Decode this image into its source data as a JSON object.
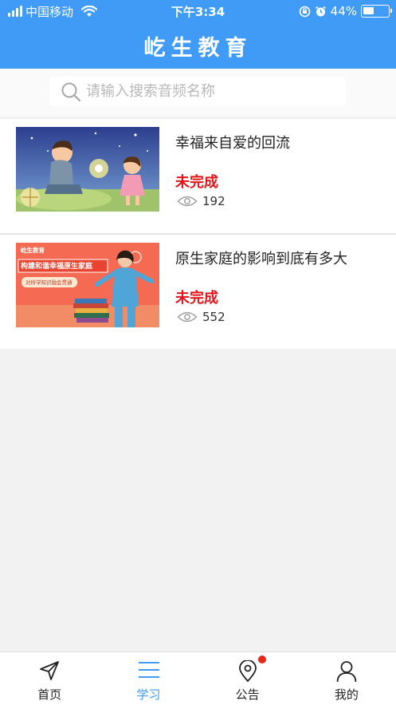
{
  "status_bar": {
    "carrier": "中国移动",
    "time": "下午3:34",
    "battery": "44%",
    "battery_level": 0.44
  },
  "header": {
    "title": "屹生教育"
  },
  "search": {
    "placeholder": "请输入搜索音频名称"
  },
  "items": [
    {
      "title": "幸福来自爱的回流",
      "status": "未完成",
      "views": "192"
    },
    {
      "title": "原生家庭的影响到底有多大",
      "status": "未完成",
      "views": "552",
      "thumb_texts": [
        "屹生教育",
        "构建和谐幸福原生家庭",
        "对所学知识融会贯通"
      ]
    }
  ],
  "tabs": [
    {
      "label": "首页",
      "icon": "send-icon"
    },
    {
      "label": "学习",
      "icon": "menu-icon"
    },
    {
      "label": "公告",
      "icon": "location-pin-icon"
    },
    {
      "label": "我的",
      "icon": "user-icon"
    }
  ],
  "colors": {
    "primary": "#3f9bf5",
    "status_red": "#e3151b",
    "badge_red": "#e8261a"
  }
}
